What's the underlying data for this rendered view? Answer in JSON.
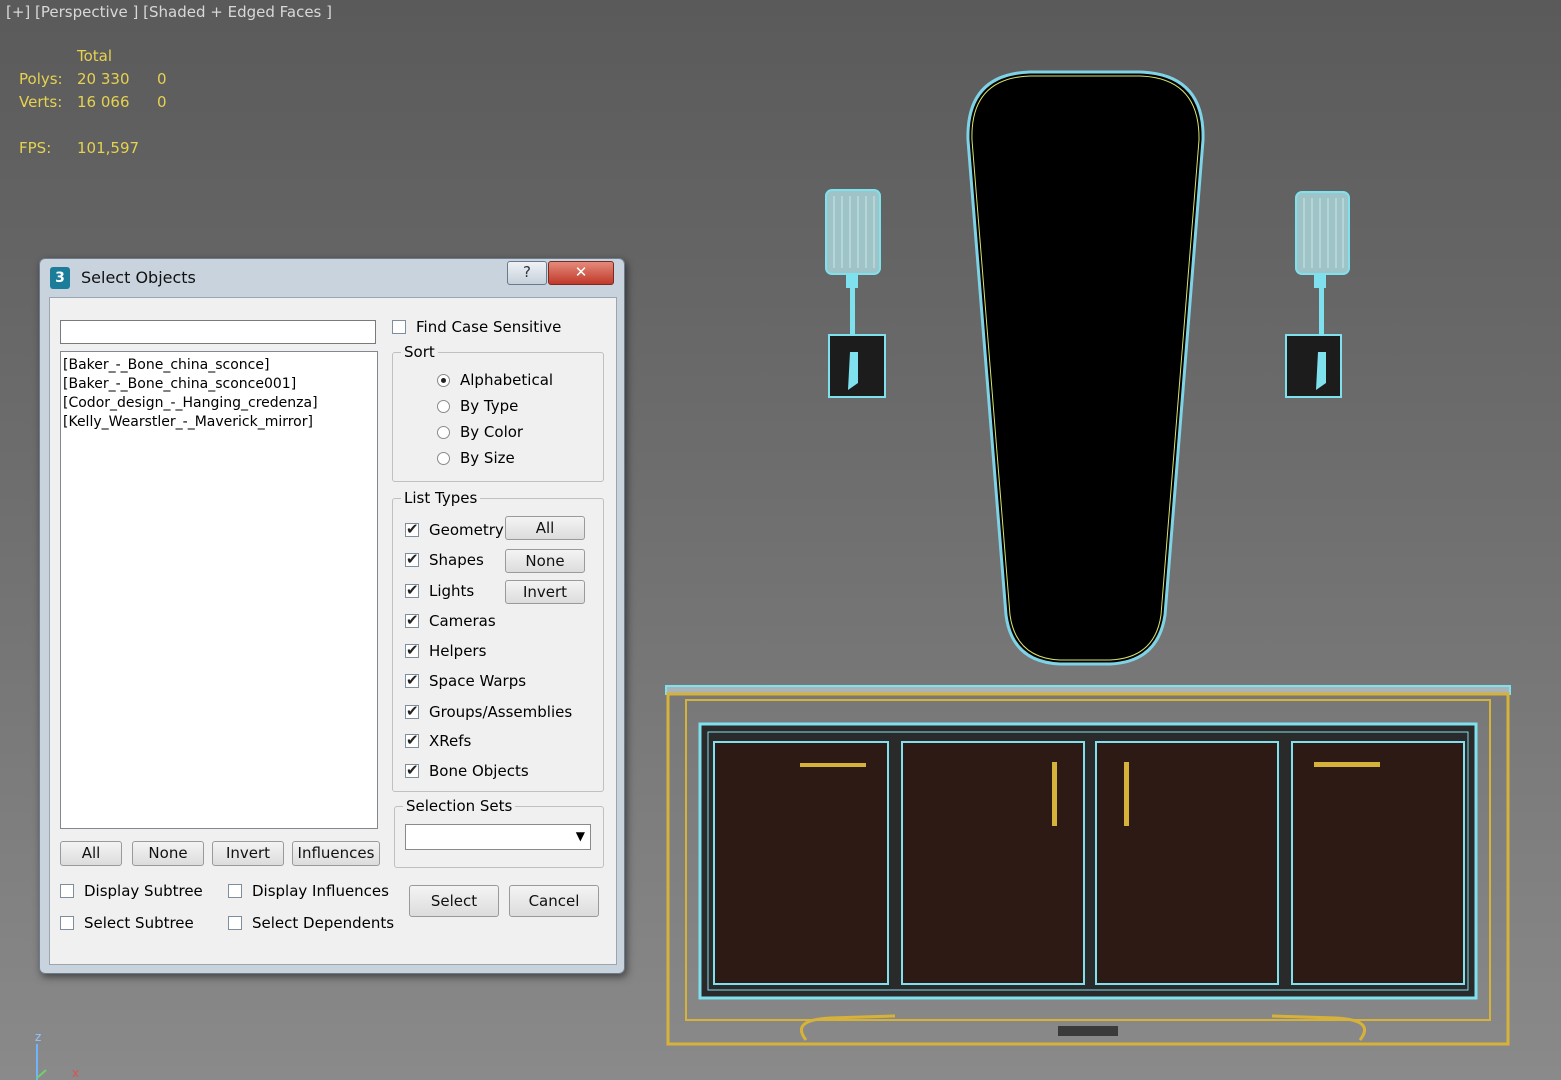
{
  "viewport": {
    "label": "[+] [Perspective ] [Shaded + Edged Faces ]",
    "stats": {
      "total_header": "Total",
      "polys_label": "Polys:",
      "polys_total": "20 330",
      "polys_sel": "0",
      "verts_label": "Verts:",
      "verts_total": "16 066",
      "verts_sel": "0",
      "fps_label": "FPS:",
      "fps_value": "101,597"
    },
    "axis_z": "z",
    "axis_x": "x"
  },
  "dialog": {
    "title": "Select Objects",
    "help_label": "?",
    "close_label": "✕",
    "search_value": "",
    "objects": [
      "[Baker_-_Bone_china_sconce]",
      "[Baker_-_Bone_china_sconce001]",
      "[Codor_design_-_Hanging_credenza]",
      "[Kelly_Wearstler_-_Maverick_mirror]"
    ],
    "list_buttons": {
      "all": "All",
      "none": "None",
      "invert": "Invert",
      "influences": "Influences"
    },
    "options": {
      "display_subtree": "Display Subtree",
      "display_influences": "Display Influences",
      "select_subtree": "Select Subtree",
      "select_dependents": "Select Dependents"
    },
    "find_case_sensitive": "Find Case Sensitive",
    "sort": {
      "label": "Sort",
      "alphabetical": "Alphabetical",
      "by_type": "By Type",
      "by_color": "By Color",
      "by_size": "By Size",
      "selected": "Alphabetical"
    },
    "list_types": {
      "label": "List Types",
      "geometry": "Geometry",
      "shapes": "Shapes",
      "lights": "Lights",
      "cameras": "Cameras",
      "helpers": "Helpers",
      "space_warps": "Space Warps",
      "groups": "Groups/Assemblies",
      "xrefs": "XRefs",
      "bone_objects": "Bone Objects",
      "all_btn": "All",
      "none_btn": "None",
      "invert_btn": "Invert"
    },
    "selection_sets": {
      "label": "Selection Sets",
      "value": ""
    },
    "select_btn": "Select",
    "cancel_btn": "Cancel"
  }
}
